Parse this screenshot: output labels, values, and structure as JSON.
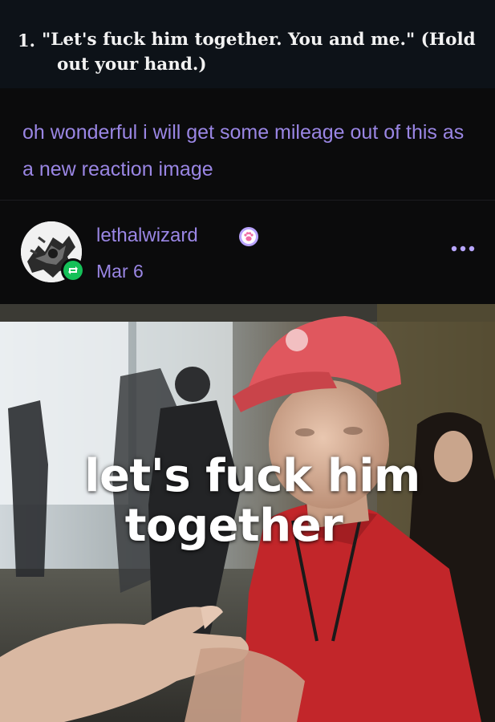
{
  "quoted_screenshot": {
    "number": "1.",
    "line1": "\"Let's fuck him together. You and me.\" (Hold",
    "line2": "out your hand.)"
  },
  "comment": {
    "text": "oh wonderful i will get some mileage out of this as a new reaction image"
  },
  "reblog": {
    "username": "lethalwizard",
    "date": "Mar 6",
    "avatar_icon": "avatar-image",
    "badge_icon": "reblog-icon",
    "user_badge_icon": "paw-badge-icon",
    "more_icon": "more-options-icon"
  },
  "meme": {
    "caption_line1": "let's fuck him",
    "caption_line2": "together"
  },
  "colors": {
    "background": "#0b0b0c",
    "accent_text": "#9a86e4",
    "reblog_green": "#15c058",
    "more_purple": "#b8a6ff"
  }
}
